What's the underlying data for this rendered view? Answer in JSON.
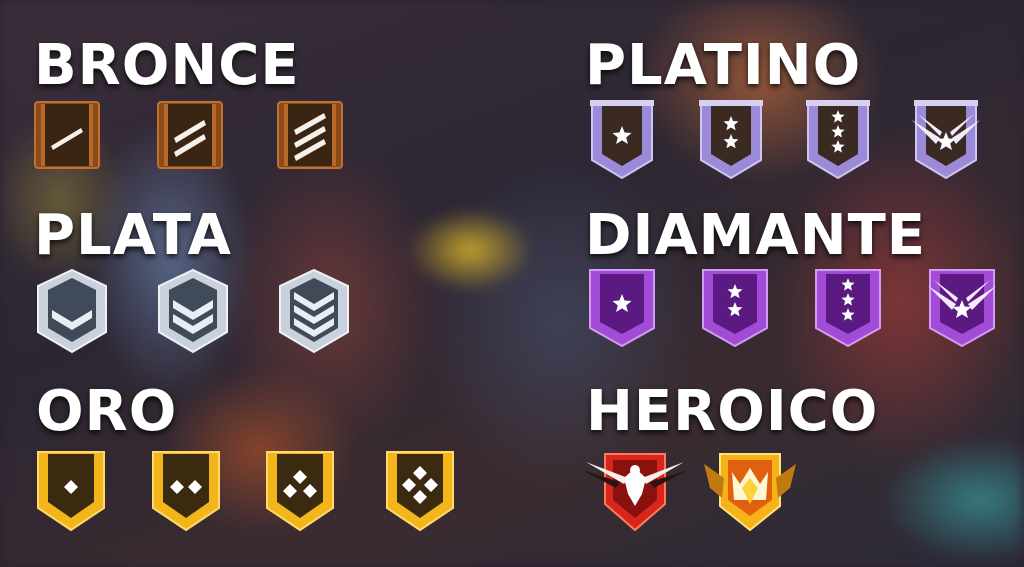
{
  "tiers": [
    {
      "title": "BRONCE",
      "badges": [
        {
          "name": "bronce-1",
          "icon": "bronze-one-stripe-icon"
        },
        {
          "name": "bronce-2",
          "icon": "bronze-two-stripes-icon"
        },
        {
          "name": "bronce-3",
          "icon": "bronze-three-stripes-icon"
        }
      ]
    },
    {
      "title": "PLATA",
      "badges": [
        {
          "name": "plata-1",
          "icon": "silver-one-chevron-icon"
        },
        {
          "name": "plata-2",
          "icon": "silver-two-chevrons-icon"
        },
        {
          "name": "plata-3",
          "icon": "silver-three-chevrons-icon"
        }
      ]
    },
    {
      "title": "ORO",
      "badges": [
        {
          "name": "oro-1",
          "icon": "gold-one-diamond-icon"
        },
        {
          "name": "oro-2",
          "icon": "gold-two-diamonds-icon"
        },
        {
          "name": "oro-3",
          "icon": "gold-three-diamonds-icon"
        },
        {
          "name": "oro-4",
          "icon": "gold-four-diamonds-icon"
        }
      ]
    },
    {
      "title": "PLATINO",
      "badges": [
        {
          "name": "platino-1",
          "icon": "platinum-one-star-icon"
        },
        {
          "name": "platino-2",
          "icon": "platinum-two-stars-icon"
        },
        {
          "name": "platino-3",
          "icon": "platinum-three-stars-icon"
        },
        {
          "name": "platino-4",
          "icon": "platinum-winged-star-icon"
        }
      ]
    },
    {
      "title": "DIAMANTE",
      "badges": [
        {
          "name": "diamante-1",
          "icon": "diamond-one-star-icon"
        },
        {
          "name": "diamante-2",
          "icon": "diamond-two-stars-icon"
        },
        {
          "name": "diamante-3",
          "icon": "diamond-three-stars-icon"
        },
        {
          "name": "diamante-4",
          "icon": "diamond-winged-star-icon"
        }
      ]
    },
    {
      "title": "HEROICO",
      "badges": [
        {
          "name": "heroico",
          "icon": "heroic-eagle-icon"
        },
        {
          "name": "gran-maestro",
          "icon": "grandmaster-crown-icon"
        }
      ]
    }
  ],
  "colors": {
    "bronze": "#8a4a1a",
    "bronze_dark": "#3a2412",
    "silver": "#c9d2dc",
    "silver_dark": "#414a58",
    "gold": "#f2b51c",
    "gold_dark": "#3a2a10",
    "platinum": "#9b8ad8",
    "platinum_dark": "#3a2a22",
    "diamond": "#a24bd6",
    "diamond_dark": "#5a1a82",
    "heroic": "#d8261c",
    "grandmaster": "#f5b21a"
  }
}
